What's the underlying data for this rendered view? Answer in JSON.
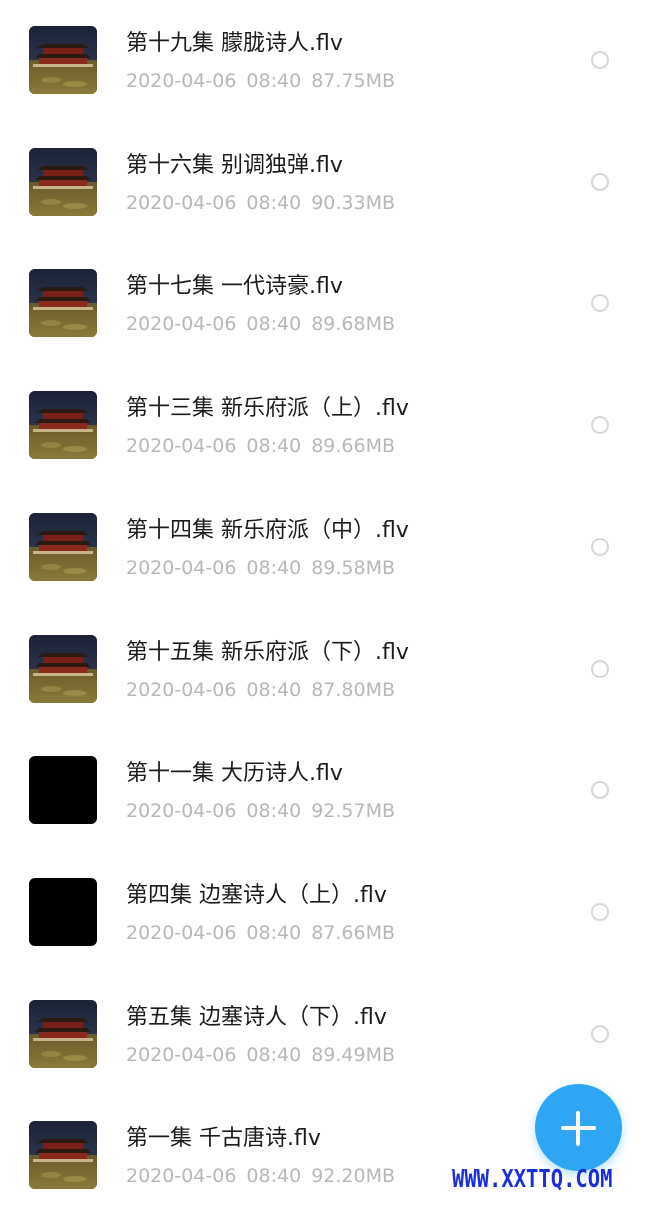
{
  "files": [
    {
      "name": "第十九集 朦胧诗人.flv",
      "date": "2020-04-06",
      "time": "08:40",
      "size": "87.75MB",
      "thumbnail": "palace-thumbnail"
    },
    {
      "name": "第十六集 别调独弹.flv",
      "date": "2020-04-06",
      "time": "08:40",
      "size": "90.33MB",
      "thumbnail": "palace-thumbnail"
    },
    {
      "name": "第十七集 一代诗豪.flv",
      "date": "2020-04-06",
      "time": "08:40",
      "size": "89.68MB",
      "thumbnail": "palace-thumbnail"
    },
    {
      "name": "第十三集 新乐府派（上）.flv",
      "date": "2020-04-06",
      "time": "08:40",
      "size": "89.66MB",
      "thumbnail": "palace-thumbnail"
    },
    {
      "name": "第十四集 新乐府派（中）.flv",
      "date": "2020-04-06",
      "time": "08:40",
      "size": "89.58MB",
      "thumbnail": "palace-thumbnail"
    },
    {
      "name": "第十五集 新乐府派（下）.flv",
      "date": "2020-04-06",
      "time": "08:40",
      "size": "87.80MB",
      "thumbnail": "palace-thumbnail"
    },
    {
      "name": "第十一集 大历诗人.flv",
      "date": "2020-04-06",
      "time": "08:40",
      "size": "92.57MB",
      "thumbnail": "black-thumbnail"
    },
    {
      "name": "第四集 边塞诗人（上）.flv",
      "date": "2020-04-06",
      "time": "08:40",
      "size": "87.66MB",
      "thumbnail": "black-thumbnail"
    },
    {
      "name": "第五集 边塞诗人（下）.flv",
      "date": "2020-04-06",
      "time": "08:40",
      "size": "89.49MB",
      "thumbnail": "palace-thumbnail"
    },
    {
      "name": "第一集 千古唐诗.flv",
      "date": "2020-04-06",
      "time": "08:40",
      "size": "92.20MB",
      "thumbnail": "palace-thumbnail"
    }
  ],
  "fab": {
    "icon": "plus-icon",
    "color": "#2fa6f4"
  },
  "watermark": {
    "text": "WWW.XXTTQ.COM"
  },
  "colors": {
    "title": "#1c1c1c",
    "meta": "#b8b8b8",
    "radio": "#d8d8d8",
    "watermark": "#1a2fd8"
  }
}
